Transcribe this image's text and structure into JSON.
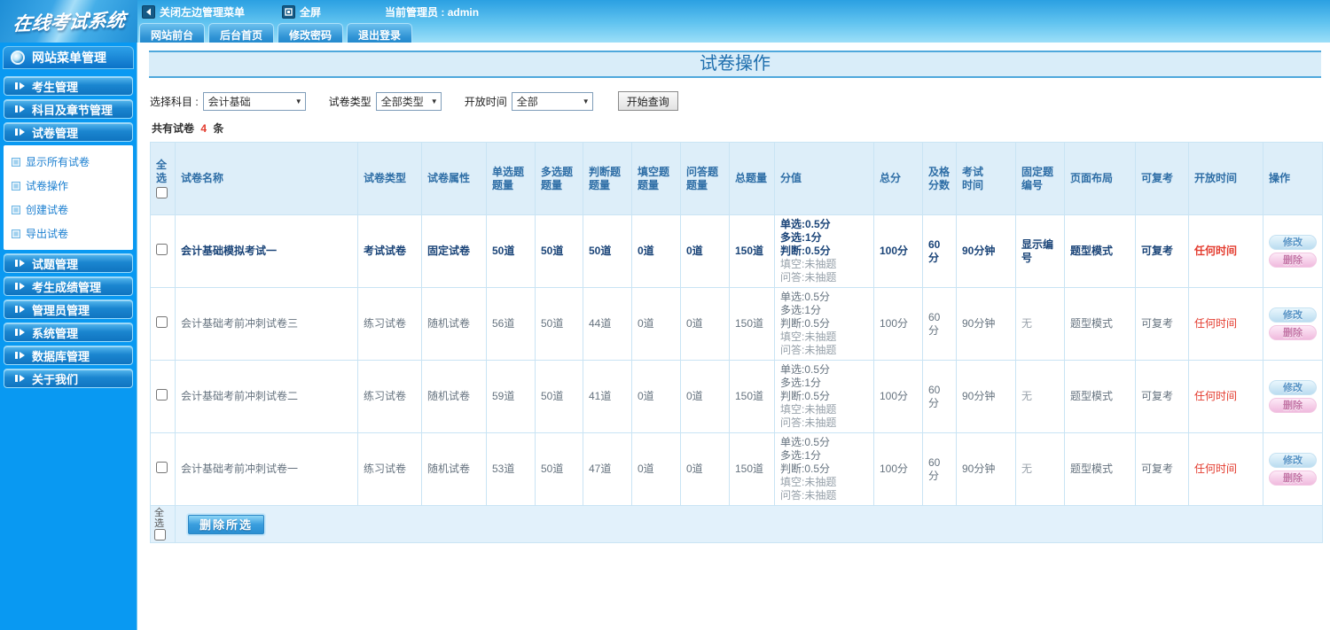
{
  "topbar": {
    "logo": "在线考试系统",
    "close_menu_label": "关闭左边管理菜单",
    "fullscreen_label": "全屏",
    "admin_label": "当前管理员 :",
    "admin_name": "admin",
    "tabs": [
      "网站前台",
      "后台首页",
      "修改密码",
      "退出登录"
    ]
  },
  "sidebar": {
    "header": "网站菜单管理",
    "groups": [
      {
        "label": "考生管理"
      },
      {
        "label": "科目及章节管理"
      },
      {
        "label": "试卷管理",
        "children": [
          "显示所有试卷",
          "试卷操作",
          "创建试卷",
          "导出试卷"
        ]
      },
      {
        "label": "试题管理"
      },
      {
        "label": "考生成绩管理"
      },
      {
        "label": "管理员管理"
      },
      {
        "label": "系统管理"
      },
      {
        "label": "数据库管理"
      },
      {
        "label": "关于我们"
      }
    ]
  },
  "main": {
    "title": "试卷操作",
    "filters": {
      "subject_label": "选择科目 :",
      "subject_value": "会计基础",
      "type_label": "试卷类型",
      "type_value": "全部类型",
      "time_label": "开放时间",
      "time_value": "全部",
      "query_button": "开始查询"
    },
    "summary": {
      "prefix": "共有试卷",
      "count": "4",
      "suffix": "条"
    },
    "table": {
      "headers": [
        "全选",
        "试卷名称",
        "试卷类型",
        "试卷属性",
        "单选题\n题量",
        "多选题\n题量",
        "判断题\n题量",
        "填空题\n题量",
        "问答题\n题量",
        "总题量",
        "分值",
        "总分",
        "及格\n分数",
        "考试\n时间",
        "固定题\n编号",
        "页面布局",
        "可复考",
        "开放时间",
        "操作"
      ],
      "edit_label": "修改",
      "delete_label": "删除",
      "rows": [
        {
          "name": "会计基础模拟考试一",
          "type": "考试试卷",
          "attr": "固定试卷",
          "single": "50道",
          "multi": "50道",
          "judge": "50道",
          "blank": "0道",
          "qa": "0道",
          "total_q": "150道",
          "scores": [
            "单选:0.5分",
            "多选:1分",
            "判断:0.5分",
            "填空:未抽题",
            "问答:未抽题"
          ],
          "total": "100分",
          "pass": "60分",
          "time": "90分钟",
          "fixed": "显示编号",
          "layout": "题型模式",
          "retake": "可复考",
          "open": "任何时间"
        },
        {
          "name": "会计基础考前冲刺试卷三",
          "type": "练习试卷",
          "attr": "随机试卷",
          "single": "56道",
          "multi": "50道",
          "judge": "44道",
          "blank": "0道",
          "qa": "0道",
          "total_q": "150道",
          "scores": [
            "单选:0.5分",
            "多选:1分",
            "判断:0.5分",
            "填空:未抽题",
            "问答:未抽题"
          ],
          "total": "100分",
          "pass": "60分",
          "time": "90分钟",
          "fixed": "无",
          "layout": "题型模式",
          "retake": "可复考",
          "open": "任何时间"
        },
        {
          "name": "会计基础考前冲刺试卷二",
          "type": "练习试卷",
          "attr": "随机试卷",
          "single": "59道",
          "multi": "50道",
          "judge": "41道",
          "blank": "0道",
          "qa": "0道",
          "total_q": "150道",
          "scores": [
            "单选:0.5分",
            "多选:1分",
            "判断:0.5分",
            "填空:未抽题",
            "问答:未抽题"
          ],
          "total": "100分",
          "pass": "60分",
          "time": "90分钟",
          "fixed": "无",
          "layout": "题型模式",
          "retake": "可复考",
          "open": "任何时间"
        },
        {
          "name": "会计基础考前冲刺试卷一",
          "type": "练习试卷",
          "attr": "随机试卷",
          "single": "53道",
          "multi": "50道",
          "judge": "47道",
          "blank": "0道",
          "qa": "0道",
          "total_q": "150道",
          "scores": [
            "单选:0.5分",
            "多选:1分",
            "判断:0.5分",
            "填空:未抽题",
            "问答:未抽题"
          ],
          "total": "100分",
          "pass": "60分",
          "time": "90分钟",
          "fixed": "无",
          "layout": "题型模式",
          "retake": "可复考",
          "open": "任何时间"
        }
      ],
      "footer": {
        "select_all": "全选",
        "delete_selected": "删除所选"
      }
    }
  }
}
